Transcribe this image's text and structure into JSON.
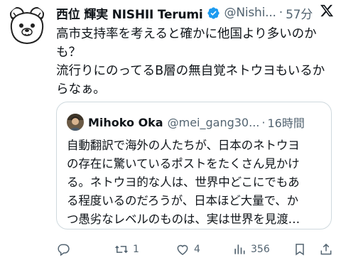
{
  "tweet": {
    "author": {
      "display_name": "西位 輝実 NISHII Terumi",
      "handle": "@Nishi...",
      "verified": true,
      "avatar_icon": "bear-avatar-icon"
    },
    "time": "57分",
    "separator": "·",
    "text_lines": [
      "高市支持率を考えると確かに他国より多いのか",
      "も？",
      "流行りにのってるB層の無自覚ネトウヨもいるか",
      "らなぁ。"
    ]
  },
  "quoted_tweet": {
    "author": {
      "display_name": "Mihoko Oka",
      "handle": "@mei_gang30...",
      "avatar_icon": "avatar-photo-icon"
    },
    "separator": "·",
    "time": "16時間",
    "text_lines": [
      "自動翻訳で海外の人たちが、日本のネトウヨ",
      "の存在に驚いているポストをたくさん見かけ",
      "る。ネトウヨ的な人は、世界中どこにでもあ",
      "る程度いるのだろうが、日本ほど大量で、か",
      "つ愚劣なレベルのものは、実は世界を見渡…"
    ]
  },
  "actions": {
    "reply": {
      "icon": "reply-icon",
      "count": ""
    },
    "repost": {
      "icon": "repost-icon",
      "count": "1"
    },
    "like": {
      "icon": "heart-icon",
      "count": "4"
    },
    "views": {
      "icon": "views-bar-chart-icon",
      "count": "356"
    },
    "bookmark": {
      "icon": "bookmark-icon"
    },
    "share": {
      "icon": "share-icon"
    }
  },
  "colors": {
    "text": "#0f1419",
    "secondary": "#536471",
    "verified": "#1d9bf0",
    "border": "#cfd9de"
  },
  "brand_icon": "x-logo-icon"
}
